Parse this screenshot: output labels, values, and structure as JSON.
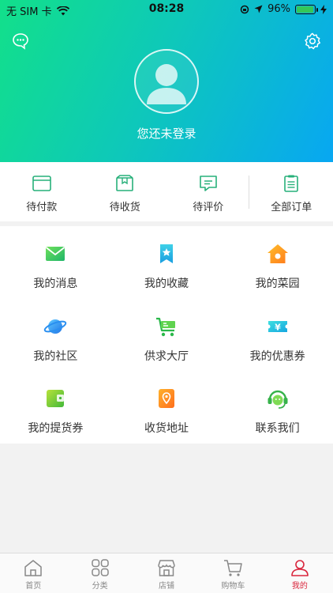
{
  "status": {
    "carrier": "无 SIM 卡",
    "time": "08:28",
    "battery": "96%",
    "battery_level": 0.96
  },
  "header": {
    "login_text": "您还未登录"
  },
  "orders": [
    {
      "label": "待付款",
      "icon": "wallet-card-icon"
    },
    {
      "label": "待收货",
      "icon": "package-box-icon"
    },
    {
      "label": "待评价",
      "icon": "comment-bubble-icon"
    },
    {
      "label": "全部订单",
      "icon": "order-list-icon"
    }
  ],
  "grid": [
    {
      "label": "我的消息",
      "icon": "message-envelope-icon"
    },
    {
      "label": "我的收藏",
      "icon": "bookmark-star-icon"
    },
    {
      "label": "我的菜园",
      "icon": "house-icon"
    },
    {
      "label": "我的社区",
      "icon": "planet-icon"
    },
    {
      "label": "供求大厅",
      "icon": "shopping-cart-icon"
    },
    {
      "label": "我的优惠券",
      "icon": "coupon-yen-icon"
    },
    {
      "label": "我的提货券",
      "icon": "voucher-icon"
    },
    {
      "label": "收货地址",
      "icon": "map-pin-icon"
    },
    {
      "label": "联系我们",
      "icon": "headset-support-icon"
    }
  ],
  "tabs": [
    {
      "label": "首页",
      "icon": "home-icon"
    },
    {
      "label": "分类",
      "icon": "category-grid-icon"
    },
    {
      "label": "店铺",
      "icon": "store-icon"
    },
    {
      "label": "购物车",
      "icon": "cart-icon"
    },
    {
      "label": "我的",
      "icon": "user-icon",
      "active": true
    }
  ],
  "colors": {
    "accent": "#d9253c",
    "order_icon": "#27b07a",
    "header_start": "#12e08a",
    "header_end": "#08a7f2"
  }
}
